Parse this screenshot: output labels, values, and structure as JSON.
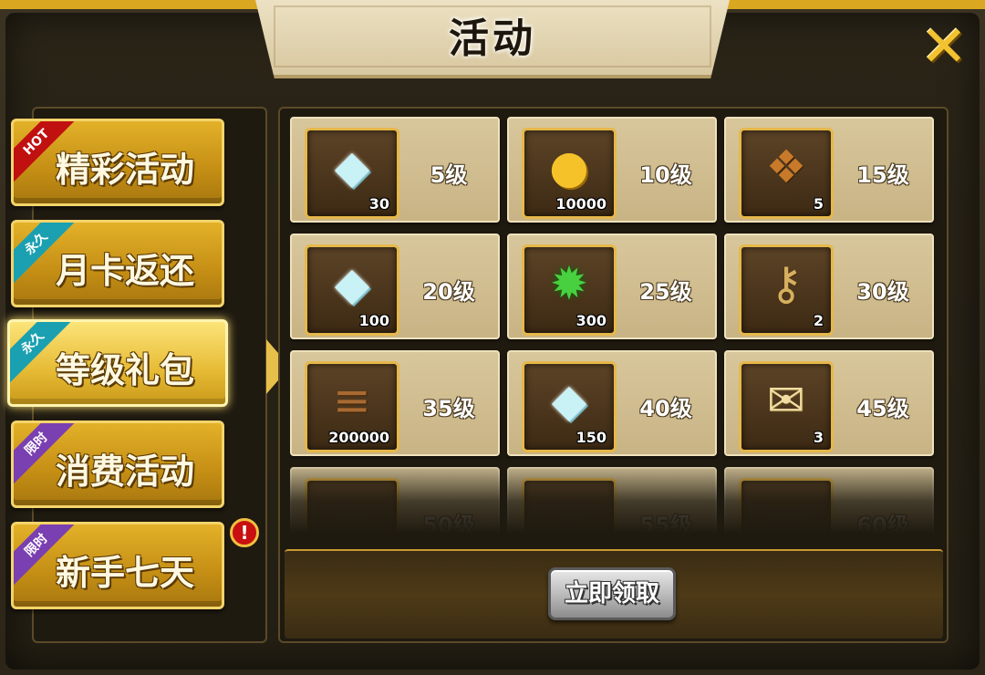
{
  "title": "活动",
  "close_icon": "close-icon",
  "tabs": [
    {
      "label": "精彩活动",
      "ribbon": "HOT",
      "ribbon_color": "red",
      "active": false
    },
    {
      "label": "月卡返还",
      "ribbon": "永久",
      "ribbon_color": "teal",
      "active": false
    },
    {
      "label": "等级礼包",
      "ribbon": "永久",
      "ribbon_color": "teal",
      "active": true
    },
    {
      "label": "消费活动",
      "ribbon": "限时",
      "ribbon_color": "purple",
      "active": false
    },
    {
      "label": "新手七天",
      "ribbon": "限时",
      "ribbon_color": "purple",
      "active": false,
      "alert": "!"
    }
  ],
  "rewards": [
    {
      "level": "5级",
      "item": "diamond-icon",
      "count": "30"
    },
    {
      "level": "10级",
      "item": "gold-coin-icon",
      "count": "10000"
    },
    {
      "level": "15级",
      "item": "rune-fragment-icon",
      "count": "5"
    },
    {
      "level": "20级",
      "item": "diamond-icon",
      "count": "100"
    },
    {
      "level": "25级",
      "item": "green-gem-icon",
      "count": "300"
    },
    {
      "level": "30级",
      "item": "key-icon",
      "count": "2"
    },
    {
      "level": "35级",
      "item": "wood-logs-icon",
      "count": "200000"
    },
    {
      "level": "40级",
      "item": "diamond-icon",
      "count": "150"
    },
    {
      "level": "45级",
      "item": "scroll-icon",
      "count": "3"
    },
    {
      "level": "50级",
      "item": "spiky-item-icon",
      "count": ""
    },
    {
      "level": "55级",
      "item": "leaf-item-icon",
      "count": ""
    },
    {
      "level": "60级",
      "item": "stone-item-icon",
      "count": ""
    }
  ],
  "claim_button": "立即领取",
  "colors": {
    "accent": "#e6b84a",
    "panel": "#1f1a10",
    "cell": "#d8c79c"
  }
}
